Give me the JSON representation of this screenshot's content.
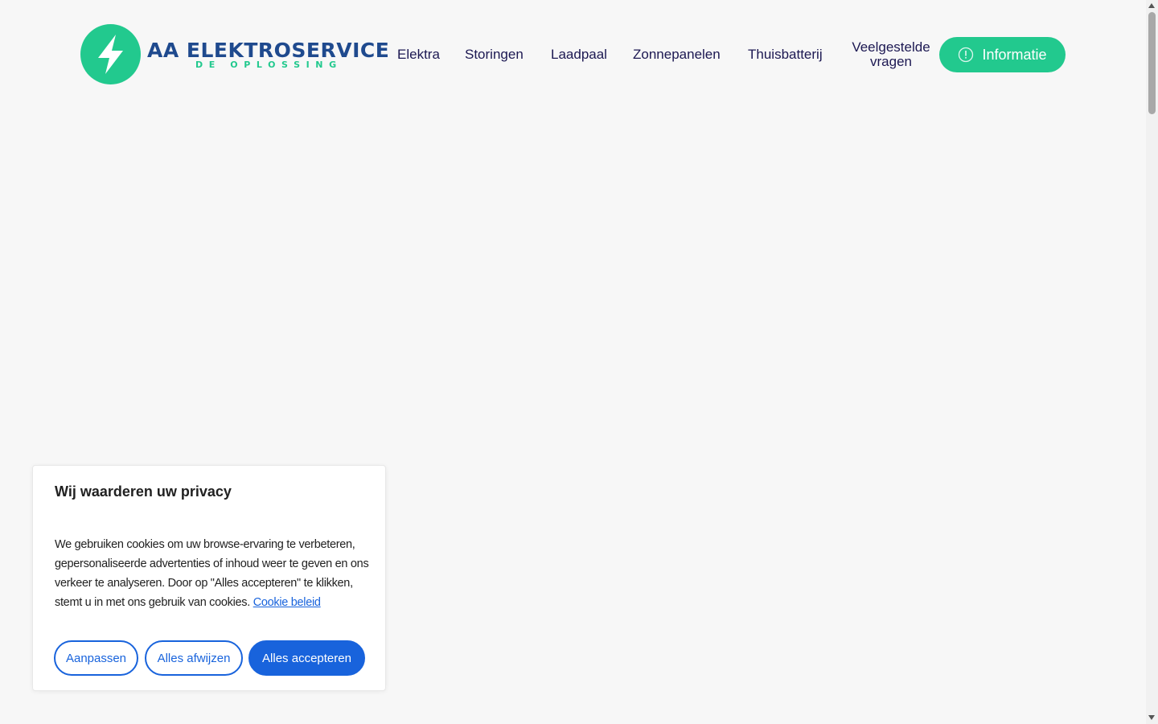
{
  "brand": {
    "title": "AA ELEKTROSERVICE",
    "subtitle": "DE OPLOSSING",
    "primary_color": "#22c98e",
    "title_color": "#1f4a8e"
  },
  "nav": {
    "items": [
      {
        "label": "Elektra"
      },
      {
        "label": "Storingen"
      },
      {
        "label": "Laadpaal"
      },
      {
        "label": "Zonnepanelen"
      },
      {
        "label": "Thuisbatterij"
      },
      {
        "label": "Veelgestelde vragen"
      }
    ],
    "cta_label": "Informatie",
    "cta_icon": "info-icon",
    "text_color": "#1c1852"
  },
  "cookie": {
    "title": "Wij waarderen uw privacy",
    "body": "We gebruiken cookies om uw browse-ervaring te verbeteren, gepersonaliseerde advertenties of inhoud weer te geven en ons verkeer te analyseren. Door op \"Alles accepteren\" te klikken, stemt u in met ons gebruik van cookies.",
    "link_label": "Cookie beleid",
    "buttons": {
      "customize": "Aanpassen",
      "reject": "Alles afwijzen",
      "accept": "Alles accepteren"
    },
    "accent_color": "#1863dc"
  }
}
